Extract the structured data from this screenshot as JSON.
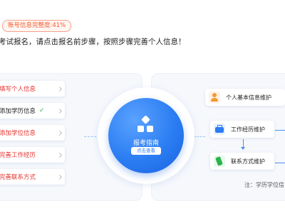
{
  "header": {
    "completeness_badge": "账号信息完整度:41%",
    "intro_text": "考试报名，请点击报名前步骤，按照步骤完善个人信息！"
  },
  "steps": [
    {
      "label": "填写个人信息",
      "label_color": "#e5322d",
      "completed": false
    },
    {
      "label": "添加学历信息",
      "label_color": "#222222",
      "completed": true,
      "status_icon": "check-icon"
    },
    {
      "label": "添加学位信息",
      "label_color": "#e5322d",
      "completed": false
    },
    {
      "label": "完善工作经历",
      "label_color": "#e5322d",
      "completed": false
    },
    {
      "label": "完善联系方式",
      "label_color": "#e5322d",
      "completed": false
    }
  ],
  "guide": {
    "title": "报考指南",
    "button_label": "点击查看",
    "icon": "grid-icon"
  },
  "flow": {
    "items": [
      {
        "label": "个人基本信息维护",
        "icon": "person-icon"
      },
      {
        "label": "工作经历维护",
        "icon": "briefcase-icon"
      },
      {
        "label": "联系方式维护",
        "icon": "phone-icon"
      }
    ],
    "note": "注：学历学位信"
  },
  "colors": {
    "accent": "#2b7df2",
    "alert": "#e5322d",
    "success": "#2bb24c"
  }
}
